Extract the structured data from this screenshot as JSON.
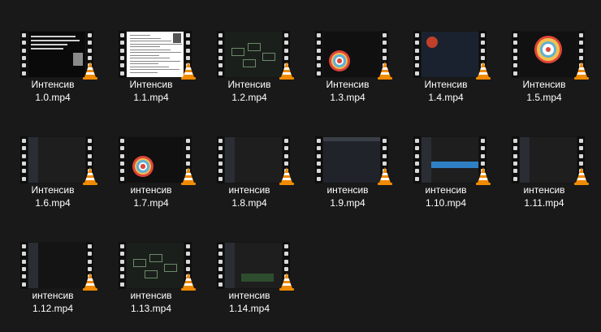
{
  "files": [
    {
      "line1": "Интенсив",
      "line2": "1.0.mp4",
      "thumb": "text-slide"
    },
    {
      "line1": "Интенсив",
      "line2": "1.1.mp4",
      "thumb": "document"
    },
    {
      "line1": "Интенсив",
      "line2": "1.2.mp4",
      "thumb": "diagram"
    },
    {
      "line1": "Интенсив",
      "line2": "1.3.mp4",
      "thumb": "circles-slide"
    },
    {
      "line1": "Интенсив",
      "line2": "1.4.mp4",
      "thumb": "profile"
    },
    {
      "line1": "Интенсив",
      "line2": "1.5.mp4",
      "thumb": "circles"
    },
    {
      "line1": "Интенсив",
      "line2": "1.6.mp4",
      "thumb": "code"
    },
    {
      "line1": "интенсив",
      "line2": "1.7.mp4",
      "thumb": "circles-slide"
    },
    {
      "line1": "интенсив",
      "line2": "1.8.mp4",
      "thumb": "code"
    },
    {
      "line1": "интенсив",
      "line2": "1.9.mp4",
      "thumb": "browser"
    },
    {
      "line1": "интенсив",
      "line2": "1.10.mp4",
      "thumb": "code-blue"
    },
    {
      "line1": "интенсив",
      "line2": "1.11.mp4",
      "thumb": "code"
    },
    {
      "line1": "интенсив",
      "line2": "1.12.mp4",
      "thumb": "code-dark"
    },
    {
      "line1": "интенсив",
      "line2": "1.13.mp4",
      "thumb": "diagram"
    },
    {
      "line1": "интенсив",
      "line2": "1.14.mp4",
      "thumb": "code-green"
    }
  ],
  "icon": "vlc-cone-icon",
  "colors": {
    "background": "#191919",
    "cone": "#f08a00",
    "text": "#ffffff"
  }
}
